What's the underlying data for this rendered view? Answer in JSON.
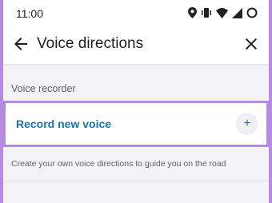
{
  "status_bar": {
    "time": "11:00",
    "icons": [
      "location-icon",
      "vibrate-icon",
      "wifi-icon",
      "signal-icon",
      "battery-icon"
    ]
  },
  "app_bar": {
    "title": "Voice directions"
  },
  "section": {
    "header": "Voice recorder"
  },
  "record_item": {
    "label": "Record new voice",
    "action_icon": "plus-icon"
  },
  "helper_text": "Create your own voice directions to guide you on the road",
  "colors": {
    "accent": "#1a73a8",
    "highlight": "#b48ae3",
    "background": "#f3f3f5"
  }
}
